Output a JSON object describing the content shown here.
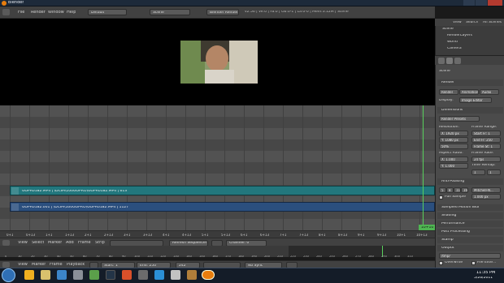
{
  "window": {
    "title": "Blender"
  },
  "header": {
    "menus": [
      "File",
      "Render",
      "Window",
      "Help"
    ],
    "screen": "Default",
    "scene": "Scene",
    "engine": "Blender Render",
    "stats": "v2.56 | Ve:0 | Fa:0 | Ob:0-1 | La:0-0 | Mem:3.12M | Scene"
  },
  "sequencer": {
    "strips": [
      {
        "label": "GOPR0182.MP4 | \\DCIM\\100GOPRO\\GOPR0182.MP4 | 613"
      },
      {
        "label": "GOPR0182.001 | \\DCIM\\100GOPRO\\GOPR0182.MP4 | 1127"
      }
    ],
    "current_frame": "10+10",
    "ruler": [
      "0+1",
      "0+13",
      "1+1",
      "1+13",
      "2+1",
      "2+13",
      "3+1",
      "3+13",
      "4+1",
      "4+13",
      "5+1",
      "5+13",
      "6+1",
      "6+13",
      "7+1",
      "7+13",
      "8+1",
      "8+13",
      "9+1",
      "9+13",
      "10+1",
      "10+13"
    ],
    "header": {
      "menus": [
        "View",
        "Select",
        "Marker",
        "Add",
        "Frame",
        "Strip"
      ],
      "refresh": "Refresh Sequencer",
      "channel": "Channel: 0"
    }
  },
  "timeline": {
    "ticks": [
      "0",
      "10",
      "20",
      "30",
      "40",
      "50",
      "60",
      "70",
      "80",
      "90",
      "100",
      "110",
      "120",
      "130",
      "140",
      "150",
      "160",
      "170",
      "180",
      "190",
      "200",
      "210",
      "220",
      "230",
      "240",
      "250",
      "260",
      "270",
      "280",
      "290",
      "300",
      "310"
    ],
    "menus": [
      "View",
      "Marker",
      "Frame",
      "Playback"
    ],
    "start": "Start: 1",
    "end": "End: 250",
    "current": "242",
    "sync": "No Sync"
  },
  "outliner": {
    "menus": [
      "View",
      "Search",
      "All Scenes"
    ],
    "items": [
      "Scene",
      "RenderLayers",
      "World",
      "Camera"
    ]
  },
  "properties": {
    "scene_label": "Scene",
    "render_header": "Render",
    "render_buttons": [
      "Render",
      "Animation",
      "Audio"
    ],
    "display_label": "Display:",
    "display_value": "Image Editor",
    "dimensions_header": "Dimensions",
    "presets": "Render Presets",
    "resolution_label": "Resolution:",
    "res_x": "X: 1920 px",
    "res_y": "Y: 1080 px",
    "res_pct": "50%",
    "frame_range_label": "Frame Range:",
    "start_frame": "Start Fr: 1",
    "end_frame": "End Fr: 250",
    "frame_step": "Frame St: 1",
    "aspect_label": "Aspect Ratio:",
    "aspect_x": "X: 1.000",
    "aspect_y": "Y: 1.000",
    "fps_label": "Frame Rate:",
    "fps_value": "24 fps",
    "time_remap": "Time Remap:",
    "remap_old": "1",
    "remap_new": "1",
    "aa_header": "Anti-Aliasing",
    "aa_values": [
      "5",
      "8",
      "11",
      "16"
    ],
    "aa_filter": "Mitchell-N...",
    "full_sample": "Full Sample",
    "filter_size": "1.000 px",
    "sections": [
      "Sampled Motion Blur",
      "Shading",
      "Performance",
      "Post Processing",
      "Stamp",
      "Output"
    ],
    "output_path": "/tmp/",
    "overwrite": "Overwrite",
    "file_ext": "File Exte..."
  },
  "taskbar": {
    "time": "11:35 PM",
    "date": "5/26/2011"
  }
}
